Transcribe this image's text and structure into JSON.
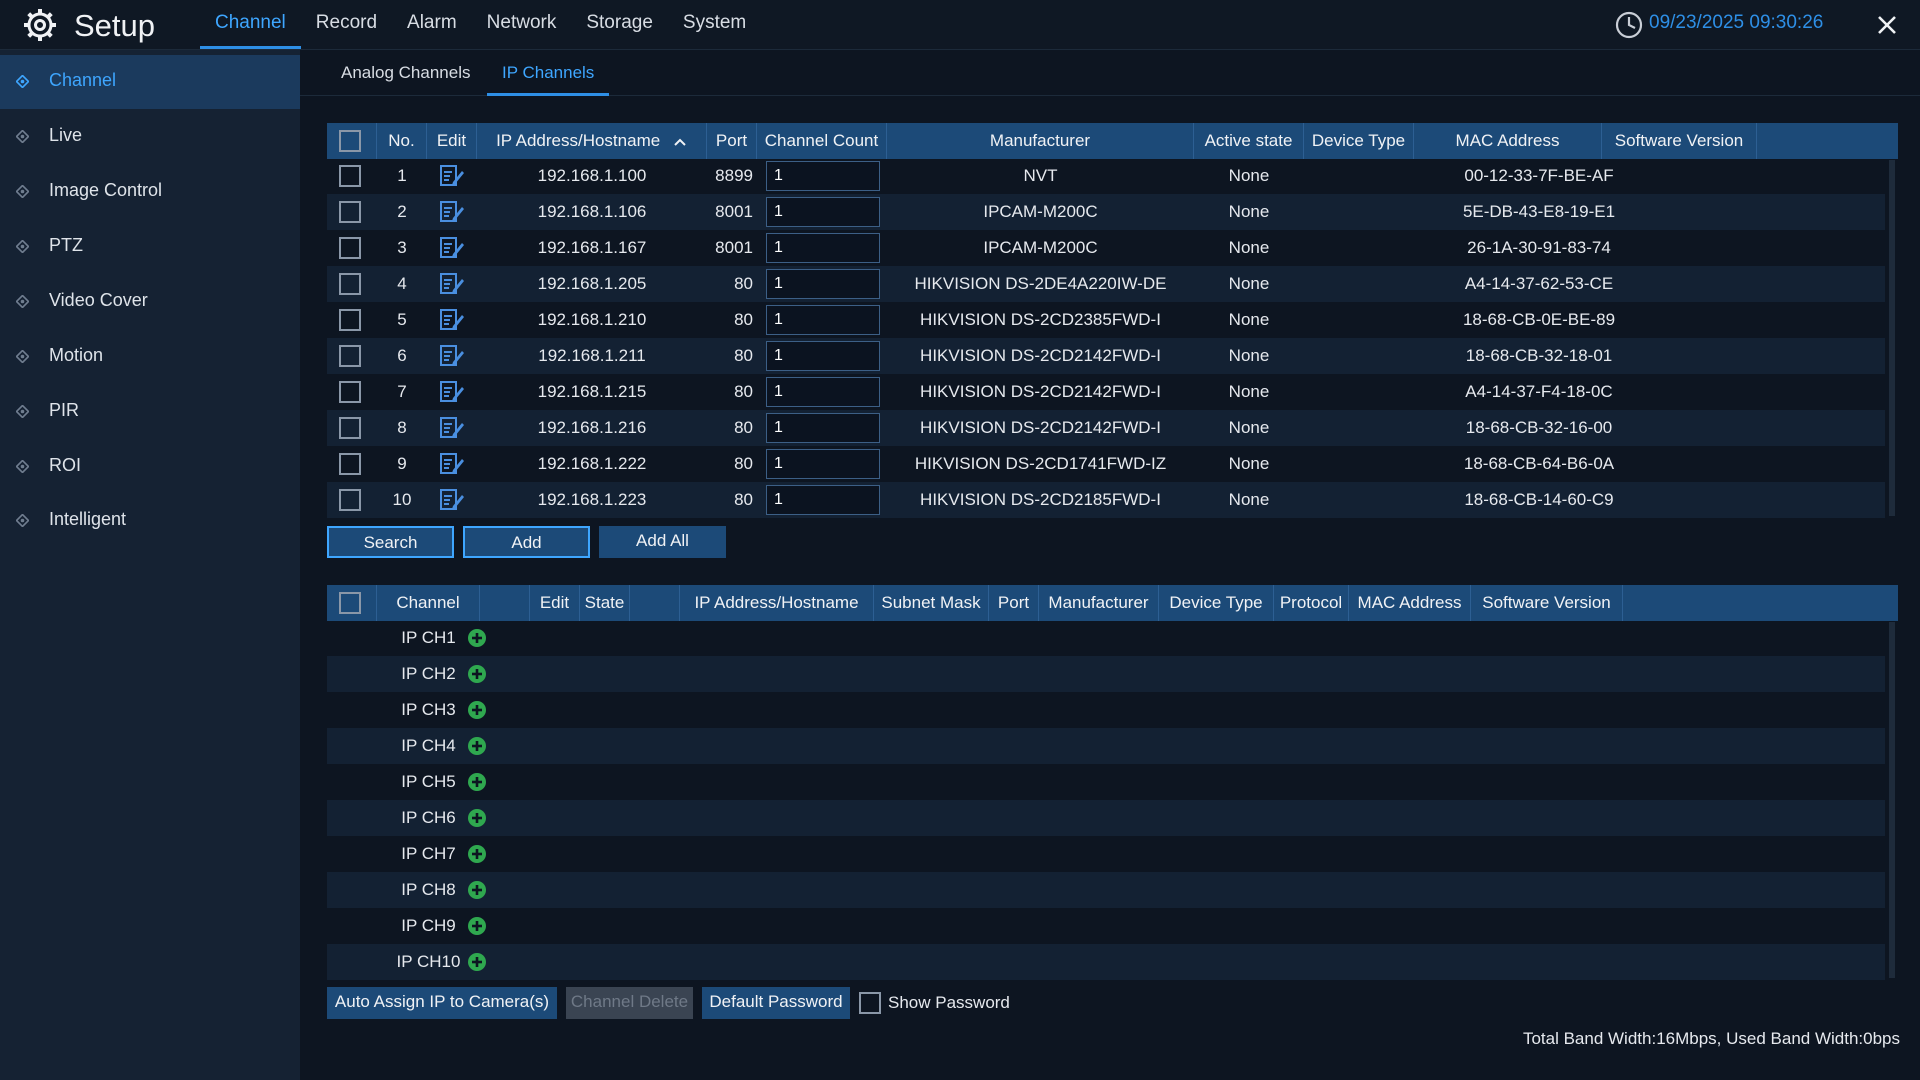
{
  "app": {
    "title": "Setup",
    "datetime": "09/23/2025 09:30:26",
    "nav": [
      "Channel",
      "Record",
      "Alarm",
      "Network",
      "Storage",
      "System"
    ]
  },
  "sidebar": {
    "items": [
      "Channel",
      "Live",
      "Image Control",
      "PTZ",
      "Video Cover",
      "Motion",
      "PIR",
      "ROI",
      "Intelligent"
    ]
  },
  "subtabs": [
    "Analog Channels",
    "IP Channels"
  ],
  "search_table": {
    "headers": [
      "No.",
      "Edit",
      "IP Address/Hostname",
      "Port",
      "Channel Count",
      "Manufacturer",
      "Active state",
      "Device Type",
      "MAC Address",
      "Software Version"
    ],
    "sort_indicator": "ascending",
    "rows": [
      {
        "no": "1",
        "ip": "192.168.1.100",
        "port": "8899",
        "count": "1",
        "manufacturer": "NVT",
        "state": "None",
        "mac": "00-12-33-7F-BE-AF"
      },
      {
        "no": "2",
        "ip": "192.168.1.106",
        "port": "8001",
        "count": "1",
        "manufacturer": "IPCAM-M200C",
        "state": "None",
        "mac": "5E-DB-43-E8-19-E1"
      },
      {
        "no": "3",
        "ip": "192.168.1.167",
        "port": "8001",
        "count": "1",
        "manufacturer": "IPCAM-M200C",
        "state": "None",
        "mac": "26-1A-30-91-83-74"
      },
      {
        "no": "4",
        "ip": "192.168.1.205",
        "port": "80",
        "count": "1",
        "manufacturer": "HIKVISION DS-2DE4A220IW-DE",
        "state": "None",
        "mac": "A4-14-37-62-53-CE"
      },
      {
        "no": "5",
        "ip": "192.168.1.210",
        "port": "80",
        "count": "1",
        "manufacturer": "HIKVISION DS-2CD2385FWD-I",
        "state": "None",
        "mac": "18-68-CB-0E-BE-89"
      },
      {
        "no": "6",
        "ip": "192.168.1.211",
        "port": "80",
        "count": "1",
        "manufacturer": "HIKVISION DS-2CD2142FWD-I",
        "state": "None",
        "mac": "18-68-CB-32-18-01"
      },
      {
        "no": "7",
        "ip": "192.168.1.215",
        "port": "80",
        "count": "1",
        "manufacturer": "HIKVISION DS-2CD2142FWD-I",
        "state": "None",
        "mac": "A4-14-37-F4-18-0C"
      },
      {
        "no": "8",
        "ip": "192.168.1.216",
        "port": "80",
        "count": "1",
        "manufacturer": "HIKVISION DS-2CD2142FWD-I",
        "state": "None",
        "mac": "18-68-CB-32-16-00"
      },
      {
        "no": "9",
        "ip": "192.168.1.222",
        "port": "80",
        "count": "1",
        "manufacturer": "HIKVISION DS-2CD1741FWD-IZ",
        "state": "None",
        "mac": "18-68-CB-64-B6-0A"
      },
      {
        "no": "10",
        "ip": "192.168.1.223",
        "port": "80",
        "count": "1",
        "manufacturer": "HIKVISION DS-2CD2185FWD-I",
        "state": "None",
        "mac": "18-68-CB-14-60-C9"
      }
    ]
  },
  "search_buttons": {
    "search": "Search",
    "add": "Add",
    "add_all": "Add All"
  },
  "channel_table": {
    "headers": [
      "Channel",
      "Edit",
      "State",
      "IP Address/Hostname",
      "Subnet Mask",
      "Port",
      "Manufacturer",
      "Device Type",
      "Protocol",
      "MAC Address",
      "Software Version"
    ],
    "rows": [
      "IP CH1",
      "IP CH2",
      "IP CH3",
      "IP CH4",
      "IP CH5",
      "IP CH6",
      "IP CH7",
      "IP CH8",
      "IP CH9",
      "IP CH10"
    ]
  },
  "footer": {
    "auto_assign": "Auto Assign IP to Camera(s)",
    "channel_delete": "Channel Delete",
    "default_password": "Default Password",
    "show_password": "Show Password",
    "bandwidth": "Total Band Width:16Mbps, Used Band Width:0bps"
  },
  "colors": {
    "accent": "#3ea6ff",
    "header_bg": "#1c4a78",
    "add_icon": "#2fa84f",
    "edit_icon": "#4a8fe0"
  },
  "icons": {
    "logo": "gear-icon",
    "clock": "clock-icon",
    "close": "close-icon",
    "sidebar": "diamond-icon",
    "edit": "edit-icon",
    "add": "plus-circle-icon",
    "sort": "chevron-up-icon"
  }
}
